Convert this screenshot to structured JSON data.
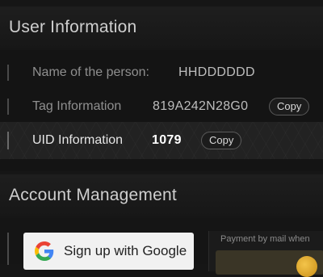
{
  "user_info": {
    "title": "User Information",
    "rows": [
      {
        "label": "Name of the person:",
        "value": "HHDDDDDD"
      },
      {
        "label": "Tag Information",
        "value": "819A242N28G0",
        "copy_label": "Copy"
      },
      {
        "label": "UID Information",
        "value": "1079",
        "copy_label": "Copy"
      }
    ]
  },
  "account_management": {
    "title": "Account Management",
    "google_button_label": "Sign up with Google",
    "mail_label": "Payment by mail when"
  },
  "icons": {
    "google": "google-g-icon",
    "coin": "coin-icon"
  },
  "colors": {
    "background": "#161616",
    "highlight_row": "#222222",
    "google_button": "#f1f1f1"
  }
}
